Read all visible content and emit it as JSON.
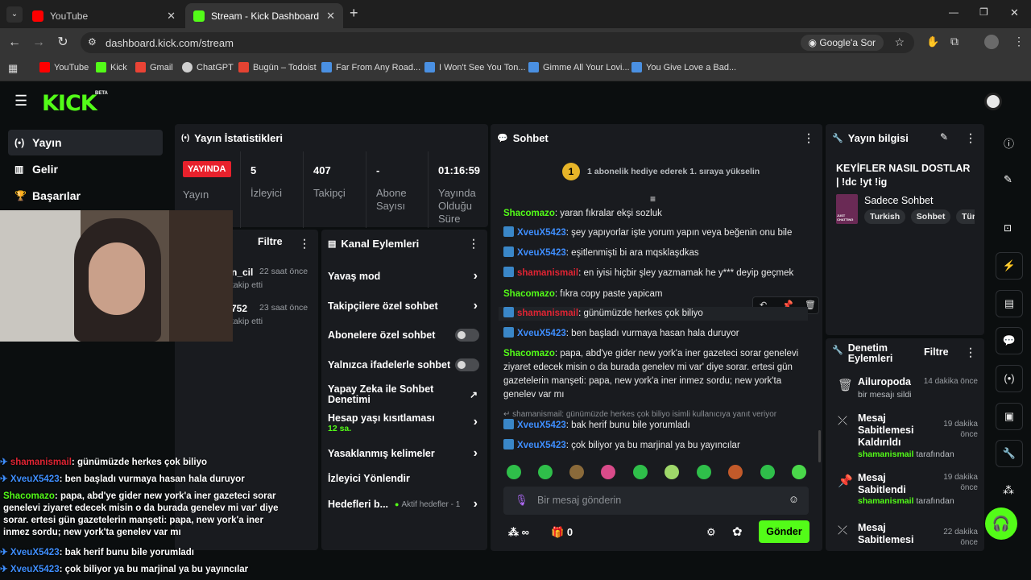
{
  "browser": {
    "tabs": [
      {
        "title": "YouTube",
        "close": "✕",
        "active": false
      },
      {
        "title": "Stream - Kick Dashboard",
        "close": "✕",
        "active": true
      }
    ],
    "new_tab": "+",
    "window_controls": {
      "minimize": "—",
      "restore": "❐",
      "close": "✕"
    },
    "url": "dashboard.kick.com/stream",
    "google_lens": "Google'a Sor",
    "bookmarks": [
      "YouTube",
      "Kick",
      "Gmail",
      "ChatGPT",
      "Bugün – Todoist",
      "Far From Any Road...",
      "I Won't See You Ton...",
      "Gimme All Your Lovi...",
      "You Give Love a Bad..."
    ]
  },
  "kick": {
    "logo": "KICK",
    "beta": "BETA"
  },
  "sidebar": {
    "items": [
      {
        "label": "Yayın",
        "icon": "broadcast-icon"
      },
      {
        "label": "Gelir",
        "icon": "revenue-icon"
      },
      {
        "label": "Başarılar",
        "icon": "trophy-icon"
      }
    ]
  },
  "stats": {
    "title": "Yayın İstatistikleri",
    "live_badge": "YAYINDA",
    "live_label": "Yayın",
    "items": [
      {
        "value": "5",
        "label": "İzleyici"
      },
      {
        "value": "407",
        "label": "Takipçi"
      },
      {
        "value": "-",
        "label": "Abone Sayısı"
      },
      {
        "value": "01:16:59",
        "label": "Yayında Olduğu Süre"
      }
    ]
  },
  "activity": {
    "filter": "Filtre",
    "items": [
      {
        "name": "n_cil",
        "time": "22 saat önce",
        "action": "takip etti"
      },
      {
        "name": "752",
        "time": "23 saat önce",
        "action": "takip etti"
      }
    ]
  },
  "channel_actions": {
    "title": "Kanal Eylemleri",
    "items": [
      {
        "label": "Yavaş mod",
        "type": "chevron"
      },
      {
        "label": "Takipçilere özel sohbet",
        "type": "chevron"
      },
      {
        "label": "Abonelere özel sohbet",
        "type": "toggle"
      },
      {
        "label": "Yalnızca ifadelerle sohbet",
        "type": "toggle"
      },
      {
        "label": "Yapay Zeka ile Sohbet Denetimi",
        "type": "external"
      },
      {
        "label": "Hesap yaşı kısıtlaması",
        "sub": "12 sa.",
        "type": "chevron"
      },
      {
        "label": "Yasaklanmış kelimeler",
        "type": "chevron"
      },
      {
        "label": "İzleyici Yönlendir",
        "type": "none"
      },
      {
        "label": "Hedefleri b...",
        "sub": "Aktif hedefler - 1",
        "type": "chevron"
      }
    ]
  },
  "chat": {
    "title": "Sohbet",
    "gift_notice": "1 abonelik hediye ederek 1. sıraya yükselin",
    "gift_rank": "1",
    "messages": [
      {
        "user": "Shacomazo",
        "color": "u1",
        "badge": false,
        "text": ": yaran fıkralar ekşi sozluk"
      },
      {
        "user": "XveuX5423",
        "color": "u2",
        "badge": true,
        "text": ": şey yapıyorlar işte yorum yapın veya beğenin onu bile"
      },
      {
        "user": "XveuX5423",
        "color": "u2",
        "badge": true,
        "text": ": eşitlenmişti bi ara mqsklaşdkas"
      },
      {
        "user": "shamanismail",
        "color": "u3",
        "badge": true,
        "text": ": en iyisi hiçbir şley yazmamak he y*** deyip geçmek"
      },
      {
        "user": "Shacomazo",
        "color": "u1",
        "badge": false,
        "text": ": fıkra copy paste yapicam"
      },
      {
        "user": "shamanismail",
        "color": "u3",
        "badge": true,
        "text": ": günümüzde herkes çok biliyo"
      },
      {
        "user": "XveuX5423",
        "color": "u2",
        "badge": true,
        "text": ": ben başladı vurmaya hasan hala duruyor"
      },
      {
        "user": "Shacomazo",
        "color": "u1",
        "badge": false,
        "text": ": papa, abd'ye gider new york'a iner gazeteci sorar genelevi ziyaret edecek misin o da burada genelev mi var' diye sorar. ertesi gün gazetelerin manşeti: papa, new york'a iner inmez sordu; new york'ta genelev var mı"
      },
      {
        "reply": "shamanismail: günümüzde herkes çok biliyo isimli kullanıcıya yanıt veriyor",
        "user": "XveuX5423",
        "color": "u2",
        "badge": true,
        "text": ": bak herif bunu bile yorumladı"
      },
      {
        "user": "XveuX5423",
        "color": "u2",
        "badge": true,
        "text": ": çok biliyor ya bu marjinal ya bu yayıncılar"
      }
    ],
    "input_placeholder": "Bir mesaj gönderin",
    "points": "∞",
    "kicks": "0",
    "send": "Gönder"
  },
  "stream_info": {
    "title": "Yayın bilgisi",
    "stream_title": "KEYİFLER NASIL DOSTLAR | !dc !yt !ig",
    "category": "Sadece Sohbet",
    "thumb_text": "JUST CHATTING",
    "tags": [
      "Turkish",
      "Sohbet",
      "Türk"
    ]
  },
  "moderation": {
    "title": "Denetim Eylemleri",
    "filter": "Filtre",
    "items": [
      {
        "title": "Ailuropoda",
        "sub": "bir mesajı sildi",
        "time": "14 dakika önce",
        "icon": "trash-icon"
      },
      {
        "title": "Mesaj Sabitlemesi Kaldırıldı",
        "user": "shamanismail",
        "by": "tarafından",
        "time": "19 dakika önce",
        "icon": "unpin-icon"
      },
      {
        "title": "Mesaj Sabitlendi",
        "user": "shamanismail",
        "by": "tarafından",
        "time": "19 dakika önce",
        "icon": "pin-icon"
      },
      {
        "title": "Mesaj Sabitlemesi",
        "time": "22 dakika önce",
        "icon": "unpin-icon"
      }
    ]
  },
  "overlay_chat": [
    {
      "user": "shamanismail",
      "color": "u3",
      "text": "günümüzde herkes çok biliyo"
    },
    {
      "user": "XveuX5423",
      "color": "u2",
      "text": "ben başladı vurmaya hasan hala duruyor"
    },
    {
      "user": "Shacomazo",
      "color": "u1",
      "text": "papa, abd'ye gider new york'a iner gazeteci sorar genelevi ziyaret edecek misin o da burada genelev mi var' diye sorar. ertesi gün gazetelerin manşeti: papa, new york'a iner inmez sordu; new york'ta genelev var mı"
    },
    {
      "user": "XveuX5423",
      "color": "u2",
      "text": "bak herif bunu bile yorumladı"
    },
    {
      "user": "XveuX5423",
      "color": "u2",
      "text": "çok biliyor ya bu marjinal ya bu yayıncılar"
    }
  ],
  "colors": {
    "kick_green": "#53fc18",
    "live_red": "#e8212c",
    "panel": "#191b1f"
  }
}
